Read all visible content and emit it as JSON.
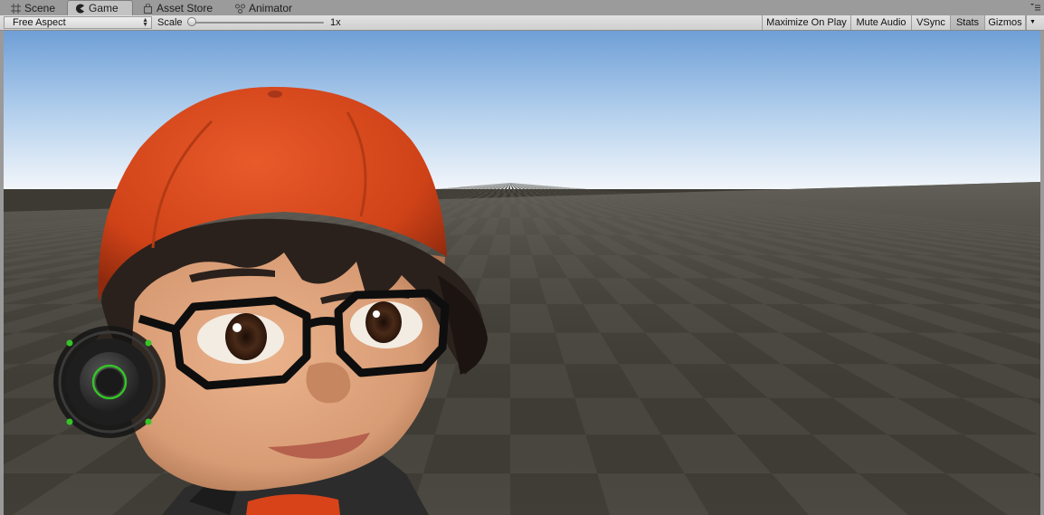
{
  "tabs": [
    {
      "label": "Scene",
      "icon": "grid-icon",
      "active": false
    },
    {
      "label": "Game",
      "icon": "pacman-icon",
      "active": true
    },
    {
      "label": "Asset Store",
      "icon": "bag-icon",
      "active": false
    },
    {
      "label": "Animator",
      "icon": "nodes-icon",
      "active": false
    }
  ],
  "toolbar": {
    "aspect": "Free Aspect",
    "scale_label": "Scale",
    "scale_value": "1x",
    "buttons": {
      "maximize": "Maximize On Play",
      "mute": "Mute Audio",
      "vsync": "VSync",
      "stats": "Stats",
      "gizmos": "Gizmos"
    }
  },
  "viewport": {
    "sky_top": "#6f9fd6",
    "sky_horizon": "#f2f6fa",
    "floor_light": "#4a4840",
    "floor_dark": "#363430",
    "cap": "#d8471b",
    "hair": "#2a211c",
    "skin": "#e0a47e",
    "glasses": "#0e0e0e",
    "joystick_ring": "#1a1a1a",
    "joystick_accent": "#35c427"
  }
}
